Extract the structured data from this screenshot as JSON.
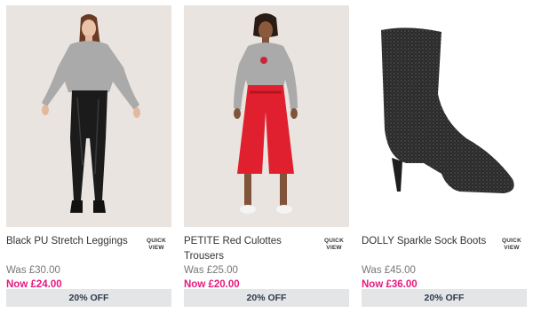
{
  "products": [
    {
      "title": "Black PU Stretch Leggings",
      "was": "Was £30.00",
      "now": "Now £24.00",
      "badge": "20% OFF",
      "quick_view_line1": "QUICK",
      "quick_view_line2": "VIEW"
    },
    {
      "title": "PETITE Red Culottes Trousers",
      "was": "Was £25.00",
      "now": "Now £20.00",
      "badge": "20% OFF",
      "quick_view_line1": "QUICK",
      "quick_view_line2": "VIEW"
    },
    {
      "title": "DOLLY Sparkle Sock Boots",
      "was": "Was £45.00",
      "now": "Now £36.00",
      "badge": "20% OFF",
      "quick_view_line1": "QUICK",
      "quick_view_line2": "VIEW"
    }
  ],
  "colors": {
    "sale_price": "#e6197e",
    "badge_bg": "#e4e5e7",
    "badge_text": "#2f3a4d",
    "photo_bg": "#e9e4df"
  }
}
